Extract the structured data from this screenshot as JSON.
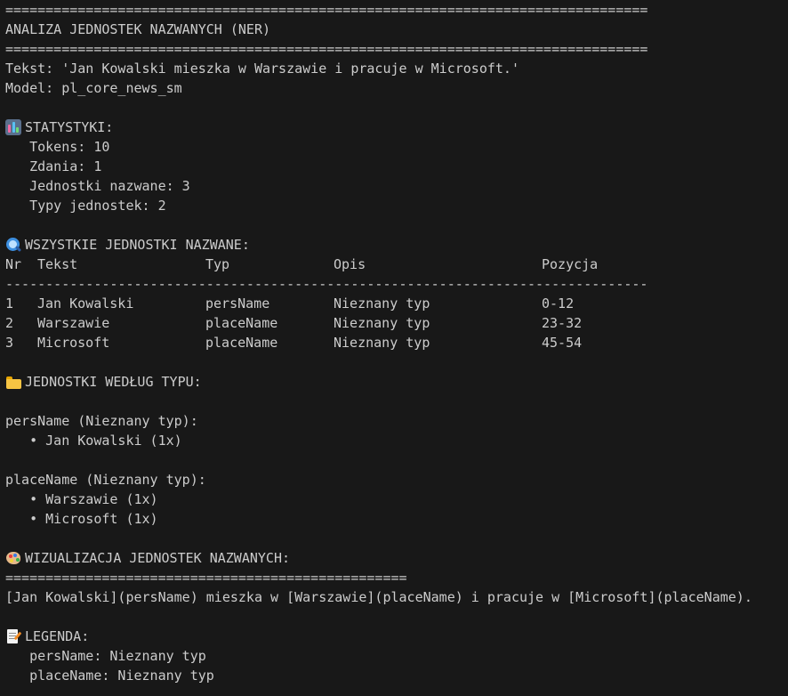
{
  "separator_double": "================================================================================",
  "separator_dash": "--------------------------------------------------------------------------------",
  "separator_double_short": "==================================================",
  "title": "ANALIZA JEDNOSTEK NAZWANYCH (NER)",
  "text_line": "Tekst: 'Jan Kowalski mieszka w Warszawie i pracuje w Microsoft.'",
  "model_line": "Model: pl_core_news_sm",
  "stats": {
    "icon": "bar-chart-icon",
    "header": "STATYSTYKI:",
    "lines": [
      "   Tokens: 10",
      "   Zdania: 1",
      "   Jednostki nazwane: 3",
      "   Typy jednostek: 2"
    ]
  },
  "entities": {
    "icon": "magnifier-icon",
    "header": "WSZYSTKIE JEDNOSTKI NAZWANE:",
    "columns": {
      "nr": "Nr",
      "text": "Tekst",
      "type": "Typ",
      "desc": "Opis",
      "pos": "Pozycja"
    },
    "rows": [
      {
        "nr": "1",
        "text": "Jan Kowalski",
        "type": "persName",
        "desc": "Nieznany typ",
        "pos": "0-12"
      },
      {
        "nr": "2",
        "text": "Warszawie",
        "type": "placeName",
        "desc": "Nieznany typ",
        "pos": "23-32"
      },
      {
        "nr": "3",
        "text": "Microsoft",
        "type": "placeName",
        "desc": "Nieznany typ",
        "pos": "45-54"
      }
    ]
  },
  "by_type": {
    "icon": "folder-icon",
    "header": "JEDNOSTKI WEDŁUG TYPU:",
    "groups": [
      {
        "label": "persName (Nieznany typ):",
        "items": [
          "   • Jan Kowalski (1x)"
        ]
      },
      {
        "label": "placeName (Nieznany typ):",
        "items": [
          "   • Warszawie (1x)",
          "   • Microsoft (1x)"
        ]
      }
    ]
  },
  "visualization": {
    "icon": "palette-icon",
    "header": "WIZUALIZACJA JEDNOSTEK NAZWANYCH:",
    "text": "[Jan Kowalski](persName) mieszka w [Warszawie](placeName) i pracuje w [Microsoft](placeName)."
  },
  "legend": {
    "icon": "memo-icon",
    "header": "LEGENDA:",
    "lines": [
      "   persName: Nieznany typ",
      "   placeName: Nieznany typ"
    ]
  },
  "colors": {
    "background": "#181818",
    "text": "#cccccc"
  }
}
